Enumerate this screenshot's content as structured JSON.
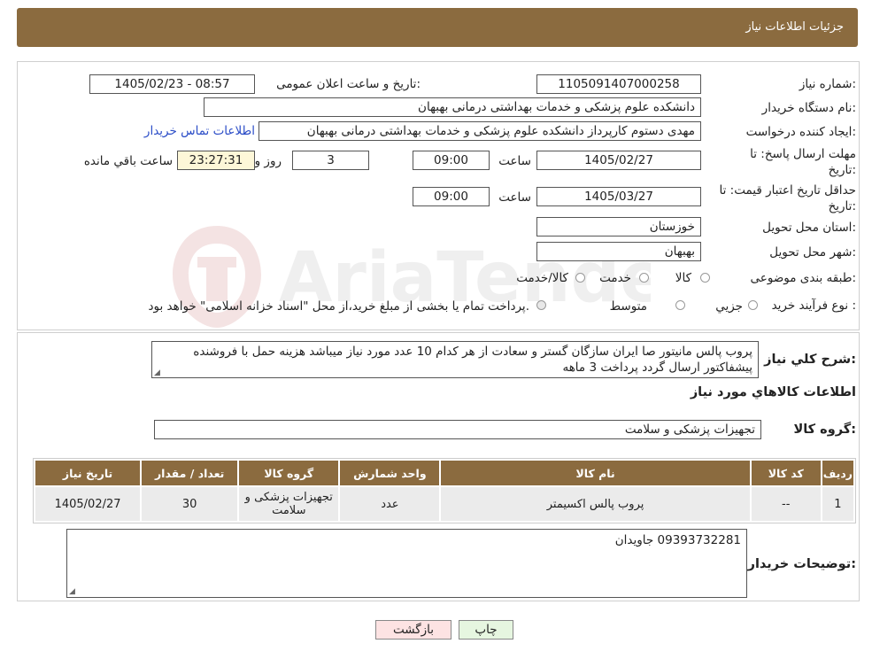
{
  "header": {
    "title": "جزئیات اطلاعات نیاز"
  },
  "form": {
    "need_number_label": "شماره نیاز:",
    "need_number": "1105091407000258",
    "announce_label": "تاریخ و ساعت اعلان عمومی:",
    "announce_value": "1405/02/23 - 08:57",
    "buyer_org_label": "نام دستگاه خریدار:",
    "buyer_org": "دانشکده علوم پزشکی و خدمات بهداشتی  درمانی بهبهان",
    "creator_label": "ایجاد کننده درخواست:",
    "creator": "مهدی دستوم کارپرداز دانشکده علوم پزشکی و خدمات بهداشتی  درمانی بهبهان",
    "contact_link": "اطلاعات تماس خریدار",
    "deadline_label_1": "مهلت ارسال پاسخ: تا",
    "deadline_label_2": "تاریخ:",
    "deadline_date": "1405/02/27",
    "time_label": "ساعت",
    "deadline_time": "09:00",
    "days_value": "3",
    "days_label": "روز و",
    "remaining_time": "23:27:31",
    "remaining_label": "ساعت باقي مانده",
    "validity_label_1": "حداقل تاریخ اعتبار قیمت: تا",
    "validity_label_2": "تاریخ:",
    "validity_date": "1405/03/27",
    "validity_time": "09:00",
    "province_label": "استان محل تحویل:",
    "province": "خوزستان",
    "city_label": "شهر محل تحویل:",
    "city": "بهبهان",
    "category_label": "طبقه بندی موضوعی:",
    "category_options": [
      "کالا",
      "خدمت",
      "کالا/خدمت"
    ],
    "process_label": "نوع فرآیند خرید :",
    "process_options": [
      "جزیي",
      "متوسط"
    ],
    "process_note": "پرداخت تمام یا بخشی از مبلغ خرید،از محل \"اسناد خزانه اسلامی\" خواهد بود."
  },
  "description": {
    "label": "شرح کلي نیاز:",
    "text": "پروب پالس مانیتور صا ایران سازگان گستر  و سعادت از هر کدام 10 عدد مورد نیاز میباشد هزینه حمل با فروشنده پیشفاکتور ارسال گردد  پرداخت 3 ماهه"
  },
  "goods": {
    "section_title": "اطلاعات کالاهاي مورد نیاز",
    "group_label": "گروه کالا:",
    "group_value": "تجهیزات پزشکی و سلامت",
    "columns": [
      "ردیف",
      "کد کالا",
      "نام کالا",
      "واحد شمارش",
      "گروه کالا",
      "تعداد / مقدار",
      "تاریخ نیاز"
    ],
    "rows": [
      [
        "1",
        "--",
        "پروب پالس اکسیمتر",
        "عدد",
        "تجهیزات پزشکی و سلامت",
        "30",
        "1405/02/27"
      ]
    ]
  },
  "buyer_notes": {
    "label": "توضیحات خریدار:",
    "text": "09393732281 جاویدان"
  },
  "buttons": {
    "print": "چاپ",
    "back": "بازگشت"
  },
  "colors": {
    "header_bg": "#8b6b3f",
    "link": "#2a4cc7",
    "back_button_bg": "#fde3e3",
    "print_button_bg": "#e6f6e0"
  }
}
